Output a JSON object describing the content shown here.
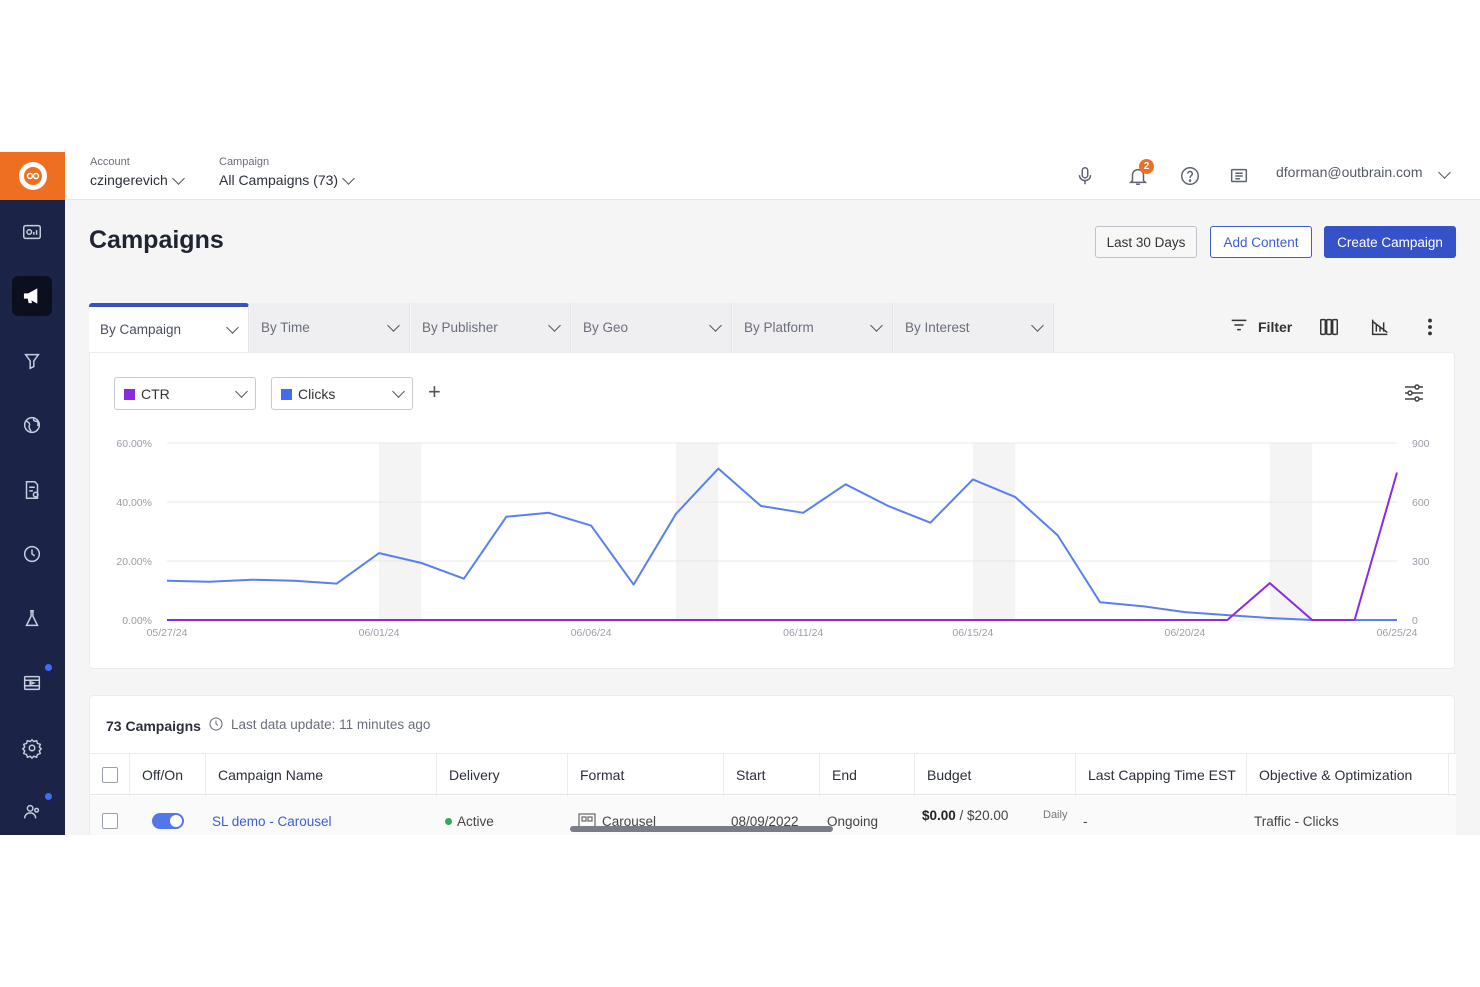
{
  "topbar": {
    "account_label": "Account",
    "account_value": "czingerevich",
    "campaign_label": "Campaign",
    "campaign_value": "All Campaigns (73)",
    "notification_count": "2",
    "user_email": "dforman@outbrain.com"
  },
  "sidebar": {
    "items": [
      "dashboard-icon",
      "megaphone-icon",
      "funnel-icon",
      "globe-icon",
      "report-icon",
      "clock-icon",
      "flask-icon",
      "media-icon",
      "settings-icon",
      "users-icon"
    ],
    "active_index": 1
  },
  "header": {
    "title": "Campaigns",
    "date_range_label": "Last 30 Days",
    "add_content_label": "Add Content",
    "create_campaign_label": "Create Campaign"
  },
  "tabs": [
    {
      "label": "By Campaign"
    },
    {
      "label": "By Time"
    },
    {
      "label": "By Publisher"
    },
    {
      "label": "By Geo"
    },
    {
      "label": "By Platform"
    },
    {
      "label": "By Interest"
    }
  ],
  "tools": {
    "filter_label": "Filter"
  },
  "metrics": [
    {
      "label": "CTR",
      "color": "#8a2be2"
    },
    {
      "label": "Clicks",
      "color": "#3d6df2"
    }
  ],
  "chart_data": {
    "type": "line",
    "x": [
      "05/27/24",
      "05/28/24",
      "05/29/24",
      "05/30/24",
      "05/31/24",
      "06/01/24",
      "06/02/24",
      "06/03/24",
      "06/04/24",
      "06/05/24",
      "06/06/24",
      "06/07/24",
      "06/08/24",
      "06/09/24",
      "06/10/24",
      "06/11/24",
      "06/12/24",
      "06/13/24",
      "06/14/24",
      "06/15/24",
      "06/16/24",
      "06/17/24",
      "06/18/24",
      "06/19/24",
      "06/20/24",
      "06/21/24",
      "06/22/24",
      "06/23/24",
      "06/24/24",
      "06/25/24"
    ],
    "x_tick_labels": [
      "05/27/24",
      "06/01/24",
      "06/06/24",
      "06/11/24",
      "06/15/24",
      "06/20/24",
      "06/25/24"
    ],
    "y_left_ticks": [
      "0.00%",
      "20.00%",
      "40.00%",
      "60.00%"
    ],
    "y_left_range": [
      0,
      60
    ],
    "y_right_ticks": [
      "0",
      "300",
      "600",
      "900"
    ],
    "y_right_range": [
      0,
      900
    ],
    "series": [
      {
        "name": "Clicks",
        "axis": "right",
        "color": "#5a7ff0",
        "values": [
          200,
          195,
          205,
          200,
          185,
          340,
          290,
          210,
          525,
          545,
          480,
          180,
          540,
          770,
          580,
          545,
          690,
          580,
          495,
          715,
          625,
          430,
          90,
          70,
          40,
          25,
          10,
          0,
          0,
          0
        ]
      },
      {
        "name": "CTR",
        "axis": "left",
        "color": "#8a2be2",
        "values": [
          0,
          0,
          0,
          0,
          0,
          0,
          0,
          0,
          0,
          0,
          0,
          0,
          0,
          0,
          0,
          0,
          0,
          0,
          0,
          0,
          0,
          0,
          0,
          0,
          0,
          0,
          12.5,
          0,
          0,
          50
        ]
      }
    ],
    "weekend_bands": [
      [
        "06/01/24",
        "06/02/24"
      ],
      [
        "06/08/24",
        "06/09/24"
      ],
      [
        "06/15/24",
        "06/16/24"
      ],
      [
        "06/22/24",
        "06/23/24"
      ]
    ],
    "grid": true
  },
  "table": {
    "count_label": "73 Campaigns",
    "update_label": "Last data update: 11 minutes ago",
    "columns": [
      "Off/On",
      "Campaign Name",
      "Delivery",
      "Format",
      "Start",
      "End",
      "Budget",
      "Last Capping Time EST",
      "Objective & Optimization"
    ],
    "rows": [
      {
        "name": "SL demo - Carousel",
        "delivery": "Active",
        "format": "Carousel",
        "start": "08/09/2022",
        "end": "Ongoing",
        "budget_spent": "$0.00",
        "budget_total": " / $20.00",
        "budget_period": "Daily",
        "capping": "-",
        "objective": "Traffic - Clicks"
      }
    ]
  }
}
